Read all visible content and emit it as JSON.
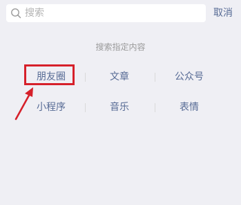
{
  "search": {
    "placeholder": "搜索",
    "cancel_label": "取消"
  },
  "section_title": "搜索指定内容",
  "categories": {
    "row1": [
      "朋友圈",
      "文章",
      "公众号"
    ],
    "row2": [
      "小程序",
      "音乐",
      "表情"
    ]
  },
  "colors": {
    "link": "#576b95",
    "annotation": "#d6202a",
    "background": "#efeff4"
  }
}
